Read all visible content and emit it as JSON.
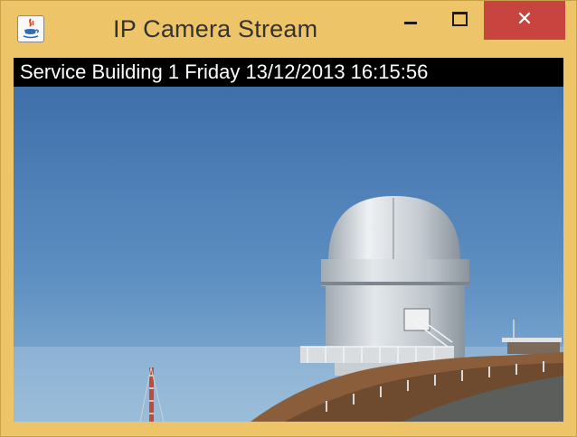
{
  "window": {
    "title": "IP Camera Stream",
    "icon": "java-cup-icon",
    "controls": {
      "minimize_icon": "minimize-icon",
      "maximize_icon": "maximize-icon",
      "close_icon": "close-icon",
      "close_glyph": "✕"
    }
  },
  "stream": {
    "overlay_text": "Service Building 1  Friday 13/12/2013 16:15:56"
  },
  "colors": {
    "window_frame": "#edc468",
    "close_button": "#c7443f",
    "sky": "#4a7cb4",
    "overlay_bg": "#000000"
  }
}
